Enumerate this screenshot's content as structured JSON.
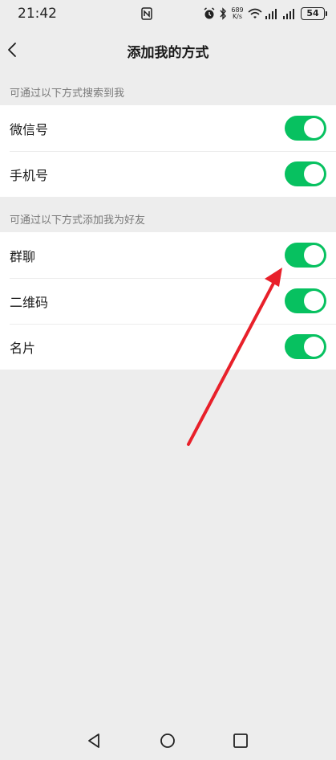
{
  "status_bar": {
    "time": "21:42",
    "net_speed_value": "689",
    "net_speed_unit": "K/s",
    "battery": "54",
    "icons": [
      "nfc-icon",
      "alarm-icon",
      "bluetooth-icon",
      "wifi-icon",
      "signal-icon",
      "signal-icon",
      "battery-icon"
    ]
  },
  "header": {
    "title": "添加我的方式",
    "back_icon": "chevron-left-icon"
  },
  "sections": [
    {
      "caption": "可通过以下方式搜索到我",
      "items": [
        {
          "label": "微信号",
          "enabled": true
        },
        {
          "label": "手机号",
          "enabled": true
        }
      ]
    },
    {
      "caption": "可通过以下方式添加我为好友",
      "items": [
        {
          "label": "群聊",
          "enabled": true
        },
        {
          "label": "二维码",
          "enabled": true
        },
        {
          "label": "名片",
          "enabled": true
        }
      ]
    }
  ],
  "colors": {
    "toggle_on": "#07c160",
    "background": "#ededed",
    "annotation_arrow": "#e8202a"
  },
  "nav_bar": {
    "icons": [
      "back-triangle-icon",
      "home-circle-icon",
      "recents-square-icon"
    ]
  }
}
